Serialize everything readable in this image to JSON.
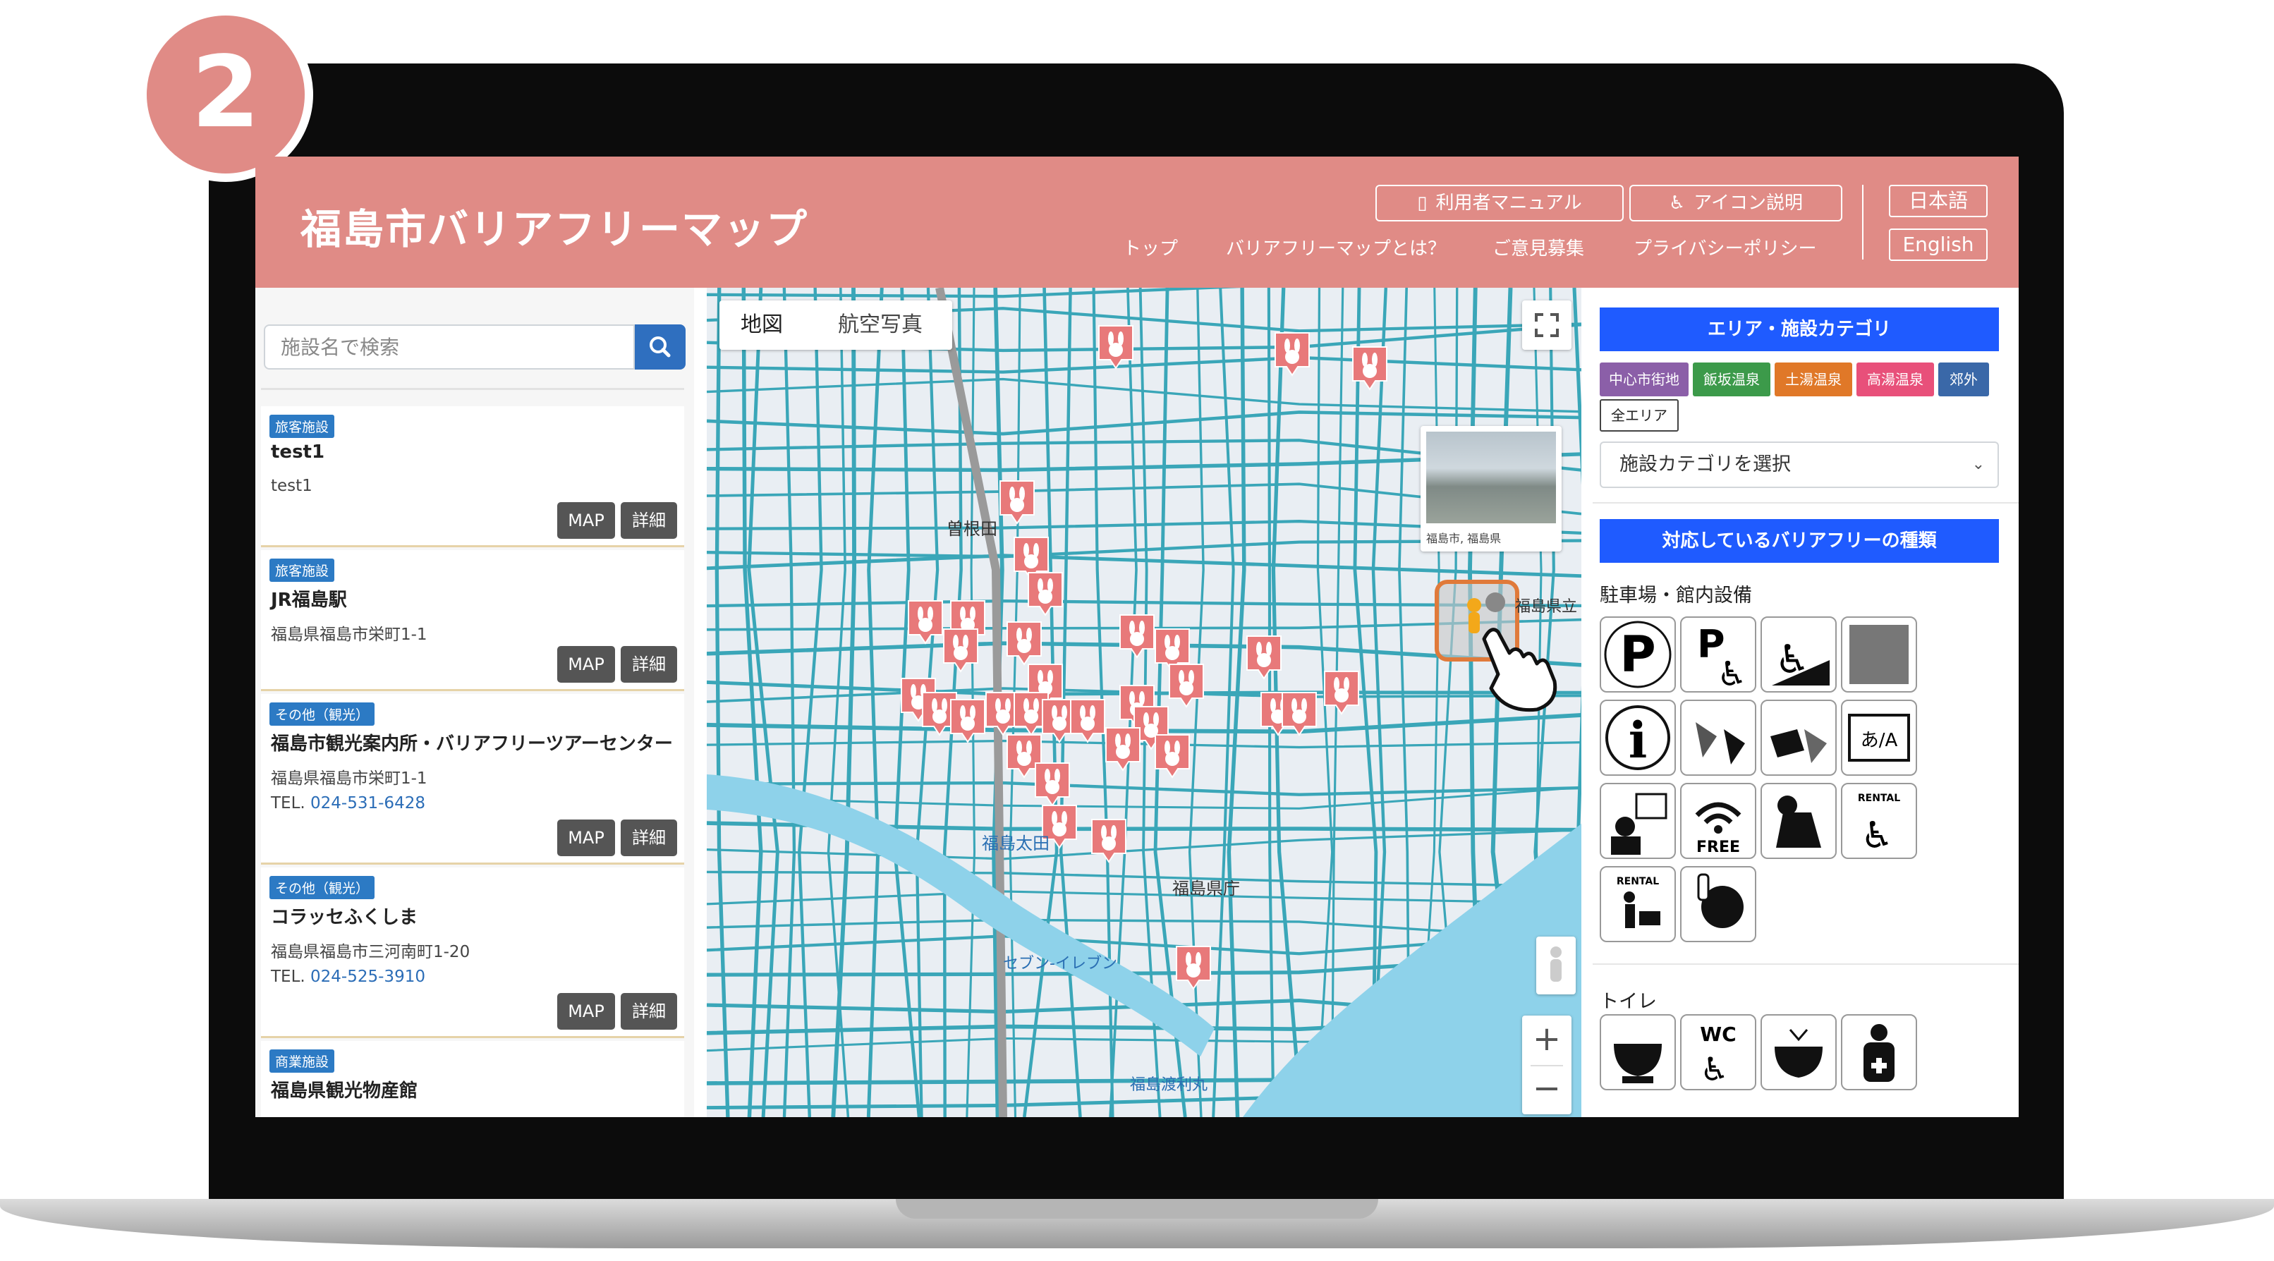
{
  "step_number": "2",
  "header": {
    "title": "福島市バリアフリーマップ",
    "manual_button": "利用者マニュアル",
    "icon_help_button": "アイコン説明",
    "nav": [
      "トップ",
      "バリアフリーマップとは？",
      "ご意見募集",
      "プライバシーポリシー"
    ],
    "lang_ja": "日本語",
    "lang_en": "English"
  },
  "search": {
    "placeholder": "施設名で検索"
  },
  "results": [
    {
      "tag": "旅客施設",
      "name": "test1",
      "address": "test1",
      "tel_label": "",
      "tel": "",
      "map_btn": "MAP",
      "detail_btn": "詳細"
    },
    {
      "tag": "旅客施設",
      "name": "JR福島駅",
      "address": "福島県福島市栄町1-1",
      "tel_label": "",
      "tel": "",
      "map_btn": "MAP",
      "detail_btn": "詳細"
    },
    {
      "tag": "その他（観光）",
      "name": "福島市観光案内所・バリアフリーツアーセンター",
      "address": "福島県福島市栄町1-1",
      "tel_label": "TEL.",
      "tel": "024-531-6428",
      "map_btn": "MAP",
      "detail_btn": "詳細"
    },
    {
      "tag": "その他（観光）",
      "name": "コラッセふくしま",
      "address": "福島県福島市三河南町1-20",
      "tel_label": "TEL.",
      "tel": "024-525-3910",
      "map_btn": "MAP",
      "detail_btn": "詳細"
    },
    {
      "tag": "商業施設",
      "name": "福島県観光物産館",
      "address": "",
      "tel_label": "",
      "tel": "",
      "map_btn": "",
      "detail_btn": ""
    }
  ],
  "map": {
    "tab_map": "地図",
    "tab_aerial": "航空写真",
    "streetview_caption": "福島市, 福島県",
    "zoom_in": "+",
    "zoom_out": "−",
    "labels": [
      "曽根田",
      "福島太田",
      "福島県庁",
      "福島渡利丸",
      "セブン-イレブン",
      "福島県立"
    ]
  },
  "right": {
    "area_heading": "エリア・施設カテゴリ",
    "areas": [
      {
        "label": "中心市街地",
        "color": "#8b5fa8"
      },
      {
        "label": "飯坂温泉",
        "color": "#3c9a4a"
      },
      {
        "label": "土湯温泉",
        "color": "#e07828"
      },
      {
        "label": "高湯温泉",
        "color": "#e8507a"
      },
      {
        "label": "郊外",
        "color": "#3a68a8"
      }
    ],
    "all_area": "全エリア",
    "category_select": "施設カテゴリを選択",
    "bf_heading": "対応しているバリアフリーの種類",
    "section_parking": "駐車場・館内設備",
    "section_toilet": "トイレ",
    "icon_texts": {
      "free": "FREE",
      "rental": "RENTAL",
      "wc": "WC",
      "lang": "あ/A"
    }
  },
  "colors": {
    "brand": "#e08b86",
    "accent_blue": "#1f5bff",
    "marker": "#e8797a",
    "road": "#3aa6b8"
  },
  "icons": [
    "parking-icon",
    "accessible-parking-icon",
    "slope-icon",
    "braille-block-icon",
    "information-icon",
    "sign-language-icon",
    "writing-board-icon",
    "multilingual-icon",
    "interpreter-icon",
    "free-wifi-icon",
    "guide-dog-icon",
    "rental-wheelchair-icon",
    "rental-stroller-icon",
    "baby-care-icon",
    "toilet-icon",
    "accessible-toilet-icon",
    "washlet-icon",
    "ostomate-icon"
  ]
}
